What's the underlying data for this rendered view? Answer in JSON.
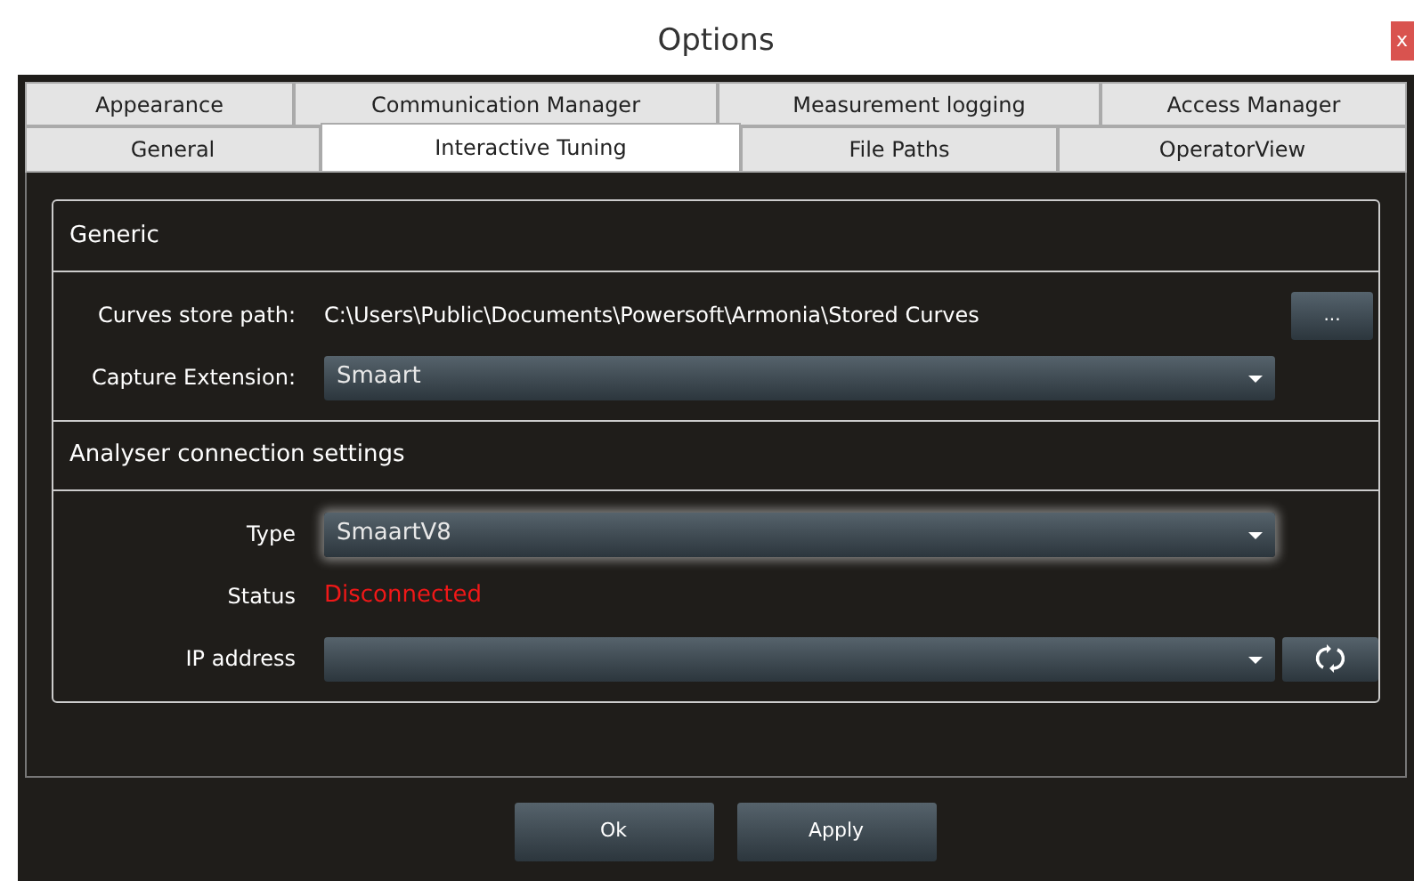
{
  "window": {
    "title": "Options",
    "close": "x"
  },
  "tab_rows": [
    [
      {
        "label": "Appearance",
        "selected": false
      },
      {
        "label": "Communication Manager",
        "selected": false
      },
      {
        "label": "Measurement logging",
        "selected": false
      },
      {
        "label": "Access Manager",
        "selected": false
      }
    ],
    [
      {
        "label": "General",
        "selected": false
      },
      {
        "label": "Interactive Tuning",
        "selected": true
      },
      {
        "label": "File Paths",
        "selected": false
      },
      {
        "label": "OperatorView",
        "selected": false
      }
    ]
  ],
  "groups": [
    {
      "title": "Generic",
      "fields": [
        {
          "kind": "path",
          "label": "Curves store path:",
          "value": "C:\\Users\\Public\\Documents\\Powersoft\\Armonia\\Stored Curves",
          "button": "..."
        },
        {
          "kind": "dropdown",
          "label": "Capture Extension:",
          "value": "Smaart",
          "focused": false
        }
      ]
    },
    {
      "title": "Analyser connection settings",
      "fields": [
        {
          "kind": "dropdown",
          "label": "Type",
          "value": "SmaartV8",
          "focused": true
        },
        {
          "kind": "status",
          "label": "Status",
          "value": "Disconnected",
          "connected": false
        },
        {
          "kind": "dropdown",
          "label": "IP address",
          "focused": false,
          "refresh": true
        }
      ]
    }
  ],
  "buttons": [
    "Ok",
    "Apply"
  ]
}
